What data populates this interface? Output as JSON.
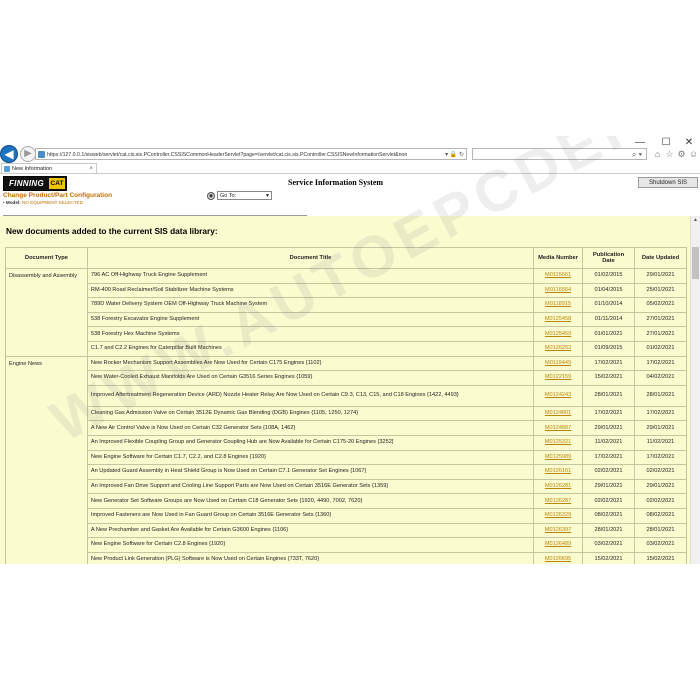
{
  "window": {
    "controls": [
      "—",
      "☐",
      "✕"
    ]
  },
  "browser": {
    "address": "https://127.0.0.1/sisweb/servlet/cat.cis.sis.PController.CSSISCommonHeaderServlet?page=/servlet/cat.cis.sis.PController.CSSISNewInformationServlet&non",
    "address_tools": "▾ 🔒 ↻",
    "search_value": "",
    "toolbar_icons": [
      "home-icon",
      "star-icon",
      "gear-icon",
      "smiley-icon"
    ],
    "tab_title": "New Information",
    "tab_close": "×"
  },
  "header": {
    "logo_text": "FINNING",
    "logo_cat": "CAT",
    "title": "Service Information System",
    "shutdown_label": "Shutdown SIS",
    "change_link": "Change Product/Part Configuration",
    "model_label": "• Model:",
    "model_value": "NO EQUIPMENT SELECTED",
    "goto_label": "Go To:"
  },
  "main": {
    "heading": "New documents added to the current SIS data library:",
    "columns": [
      "Document Type",
      "Document Title",
      "Media Number",
      "Publication Date",
      "Date Updated"
    ],
    "groups": [
      {
        "type": "Disassembly and Assembly",
        "rows": [
          {
            "title": "796 AC Off-Highway Truck Engine Supplement",
            "media": "M0115661",
            "pub": "01/02/2015",
            "upd": "29/01/2021"
          },
          {
            "title": "RM-400 Road Reclaimer/Soil Stabilizer Machine Systems",
            "media": "M0116564",
            "pub": "01/04/2015",
            "upd": "25/01/2021"
          },
          {
            "title": "789D Water Delivery System OEM Off-Highway Truck Machine System",
            "media": "M0118915",
            "pub": "01/10/2014",
            "upd": "05/02/2021"
          },
          {
            "title": "538 Forestry Excavator Engine Supplement",
            "media": "M0125458",
            "pub": "01/11/2014",
            "upd": "27/01/2021"
          },
          {
            "title": "538 Forestry Hex Machine Systems",
            "media": "M0125459",
            "pub": "01/01/2021",
            "upd": "27/01/2021"
          },
          {
            "title": "C1.7 and C2.2 Engines for Caterpillar Built Machines",
            "media": "M0126253",
            "pub": "01/09/2015",
            "upd": "01/02/2021"
          }
        ]
      },
      {
        "type": "Engine News",
        "rows": [
          {
            "title": "New Rocker Mechanism Support Assemblies Are Now Used for Certain C175 Engines {1102}",
            "media": "M0119449",
            "pub": "17/02/2021",
            "upd": "17/02/2021"
          },
          {
            "title": "New Water-Cooled Exhaust Manifolds Are Used on Certain G3516 Series Engines {1059}",
            "media": "M0122159",
            "pub": "15/02/2021",
            "upd": "04/02/2021"
          },
          {
            "title": "Improved Aftertreatment Regeneration Device (ARD) Nozzle Heater Relay Are Now Used on Certain C9.3, C13, C15, and C18 Engines {1422, 4493}",
            "media": "M0124243",
            "pub": "28/01/2021",
            "upd": "28/01/2021",
            "tall": true
          },
          {
            "title": "Cleaning Gas Admission Valve on Certain 3512E Dynamic Gas Blending (DGB) Engines {1105, 1250, 1274}",
            "media": "M0124801",
            "pub": "17/02/2021",
            "upd": "17/02/2021"
          },
          {
            "title": "A New Air Control Valve is Now Used on Certain C32 Generator Sets {108A, 1462}",
            "media": "M0124887",
            "pub": "29/01/2021",
            "upd": "29/01/2021"
          },
          {
            "title": "An Improved Flexible Coupling Group and Generator Coupling Hub are Now Available for Certain C175-20 Engines {3252}",
            "media": "M0125321",
            "pub": "11/02/2021",
            "upd": "11/02/2021"
          },
          {
            "title": "New Engine Software for Certain C1.7, C2.2, and C2.8 Engines {1920}",
            "media": "M0125989",
            "pub": "17/02/2021",
            "upd": "17/02/2021"
          },
          {
            "title": "An Updated Guard Assembly in Heat Shield Group is Now Used on Certain C7.1 Generator Set Engines {1067}",
            "media": "M0126161",
            "pub": "02/02/2021",
            "upd": "02/02/2021"
          },
          {
            "title": "An Improved Fan Drive Support and Cooling Line Support Parts are Now Used on Certain 3516E Generator Sets {1359}",
            "media": "M0126281",
            "pub": "29/01/2021",
            "upd": "29/01/2021"
          },
          {
            "title": "New Generator Set Software Groups are Now Used on Certain C18 Generator Sets {1920, 4490, 7002, 7620}",
            "media": "M0126287",
            "pub": "02/02/2021",
            "upd": "02/02/2021"
          },
          {
            "title": "Improved Fasteners are Now Used in Fan Guard Group on Certain 3516E Generator Sets {1360}",
            "media": "M0126329",
            "pub": "08/02/2021",
            "upd": "08/02/2021"
          },
          {
            "title": "A New Prechamber and Gasket Are Available for Certain G3600 Engines {1106}",
            "media": "M0126397",
            "pub": "28/01/2021",
            "upd": "28/01/2021"
          },
          {
            "title": "New Engine Software for Certain C2.8 Engines {1920}",
            "media": "M0126489",
            "pub": "03/02/2021",
            "upd": "03/02/2021"
          },
          {
            "title": "New Product Link Generation (PLG) Software is Now Used on Certain Engines {733T, 7620}",
            "media": "M0126695",
            "pub": "15/02/2021",
            "upd": "15/02/2021"
          }
        ]
      }
    ]
  },
  "watermark": "WWW.AUTOEPCDEPO.COM"
}
